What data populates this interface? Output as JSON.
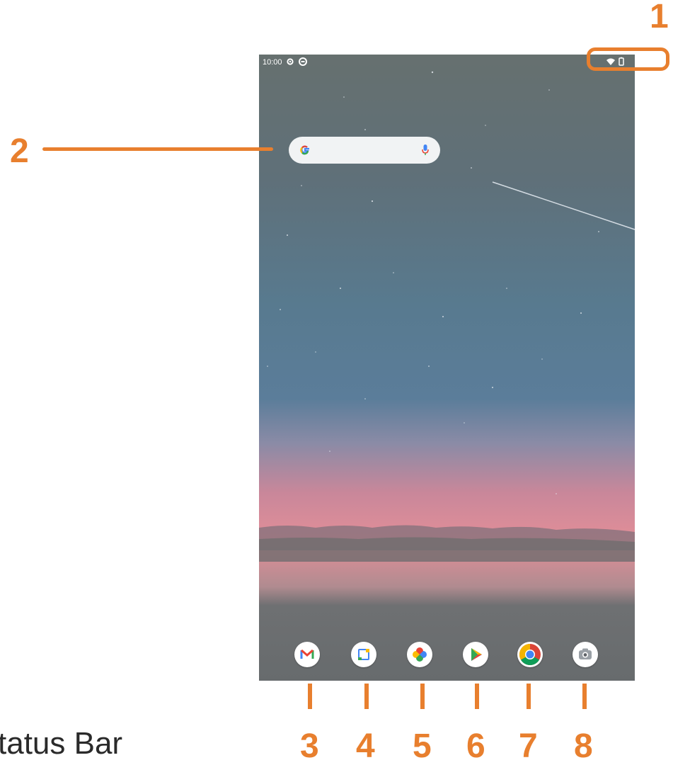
{
  "status_bar": {
    "time": "10:00",
    "left_icons": [
      "settings-icon",
      "status-circle-icon"
    ],
    "right_icons": [
      "wifi-icon",
      "battery-icon"
    ]
  },
  "search_widget": {
    "logo": "google-g-icon",
    "mic": "mic-icon"
  },
  "dock": [
    {
      "name": "gmail",
      "icon": "gmail-icon"
    },
    {
      "name": "calendar",
      "icon": "calendar-icon",
      "text": "31"
    },
    {
      "name": "photos",
      "icon": "photos-icon"
    },
    {
      "name": "play-store",
      "icon": "play-store-icon"
    },
    {
      "name": "chrome",
      "icon": "chrome-icon"
    },
    {
      "name": "camera",
      "icon": "camera-icon"
    }
  ],
  "callouts": [
    "1",
    "2",
    "3",
    "4",
    "5",
    "6",
    "7",
    "8"
  ],
  "caption": "tatus Bar",
  "colors": {
    "callout": "#e87f2e",
    "search_bg": "#f1f3f4",
    "status_text": "#ffffff"
  }
}
